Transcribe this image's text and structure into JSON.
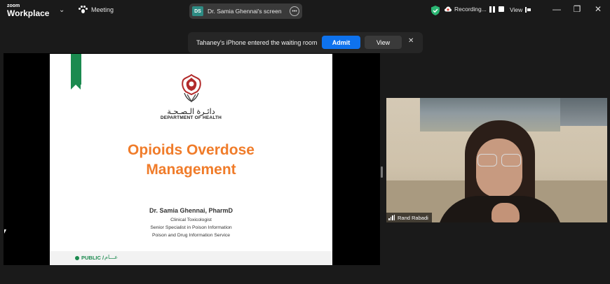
{
  "app": {
    "brand_small": "zoom",
    "brand_big": "Workplace",
    "meeting_label": "Meeting"
  },
  "share_indicator": {
    "badge": "DS",
    "label": "Dr. Samia Ghennai's screen",
    "badge_color": "#2e8c84"
  },
  "status": {
    "recording_label": "Recording...",
    "view_label": "View",
    "shield_color": "#2bb673"
  },
  "window_controls": {
    "minimize": "—",
    "restore": "❐",
    "close": "✕"
  },
  "toast": {
    "message": "Tahaney's iPhone entered the waiting room",
    "admit_label": "Admit",
    "view_label": "View",
    "close": "✕",
    "admit_color": "#0e72ed"
  },
  "slide": {
    "arabic_org": "دائـرة الـصـحـة",
    "org": "DEPARTMENT OF HEALTH",
    "title_line1": "Opioids Overdose",
    "title_line2": "Management",
    "presenter": "Dr. Samia Ghennai, PharmD",
    "lines": [
      "Clinical Toxicologist",
      "Senior Specialist in Poison Information",
      "Poison and Drug Information Service"
    ],
    "footer_label": "PUBLIC /",
    "footer_arabic": "عـــام",
    "title_color": "#f07c2a",
    "accent_color": "#1b8a4f"
  },
  "participant": {
    "name": "Rand Rabadi"
  }
}
